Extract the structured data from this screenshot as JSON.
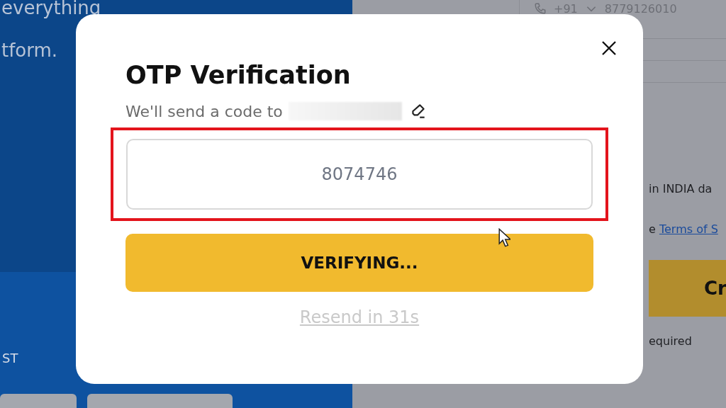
{
  "background": {
    "left": {
      "headline_lines": [
        "everything",
        "tform."
      ],
      "label": "ST"
    },
    "right": {
      "phone": {
        "country_code": "+91",
        "number": "8779126010"
      },
      "data_notice": "in INDIA da",
      "terms_prefix": "e",
      "terms_link": "Terms of S",
      "button": "Cr",
      "note": "equired"
    }
  },
  "dialog": {
    "title": "OTP Verification",
    "subtitle": "We'll send a code to",
    "otp_value": "8074746",
    "highlighted": true,
    "verify_button": {
      "label": "VERIFYING...",
      "busy": true
    },
    "resend": {
      "label": "Resend in 31s",
      "disabled": true
    }
  }
}
